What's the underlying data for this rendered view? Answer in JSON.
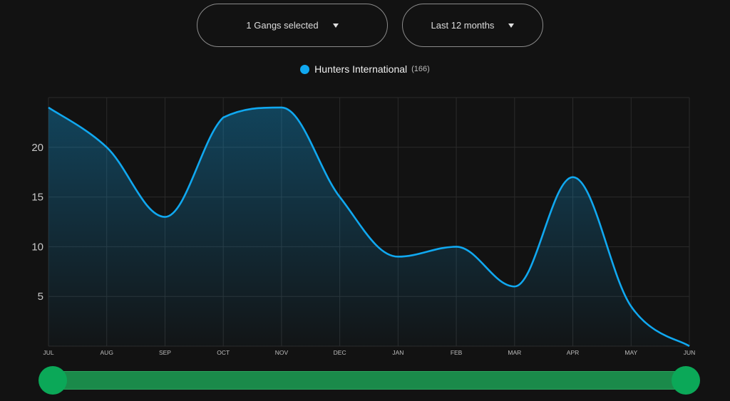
{
  "filters": {
    "gangs_label": "1 Gangs selected",
    "period_label": "Last 12 months"
  },
  "legend": {
    "series_name": "Hunters International",
    "count": "(166)",
    "color": "#10a8f0"
  },
  "chart_data": {
    "type": "area",
    "categories": [
      "JUL",
      "AUG",
      "SEP",
      "OCT",
      "NOV",
      "DEC",
      "JAN",
      "FEB",
      "MAR",
      "APR",
      "MAY",
      "JUN"
    ],
    "series": [
      {
        "name": "Hunters International",
        "values": [
          24,
          20,
          13,
          23,
          24,
          15,
          9,
          10,
          6,
          17,
          4,
          0
        ]
      }
    ],
    "yticks": [
      5,
      10,
      15,
      20
    ],
    "ylim": [
      0,
      25
    ],
    "grid": true,
    "line_color": "#10a8f0"
  },
  "range_slider": {
    "track_color": "#1a8a4a",
    "handle_color": "#0ba858",
    "start_fraction": 0,
    "end_fraction": 1
  }
}
